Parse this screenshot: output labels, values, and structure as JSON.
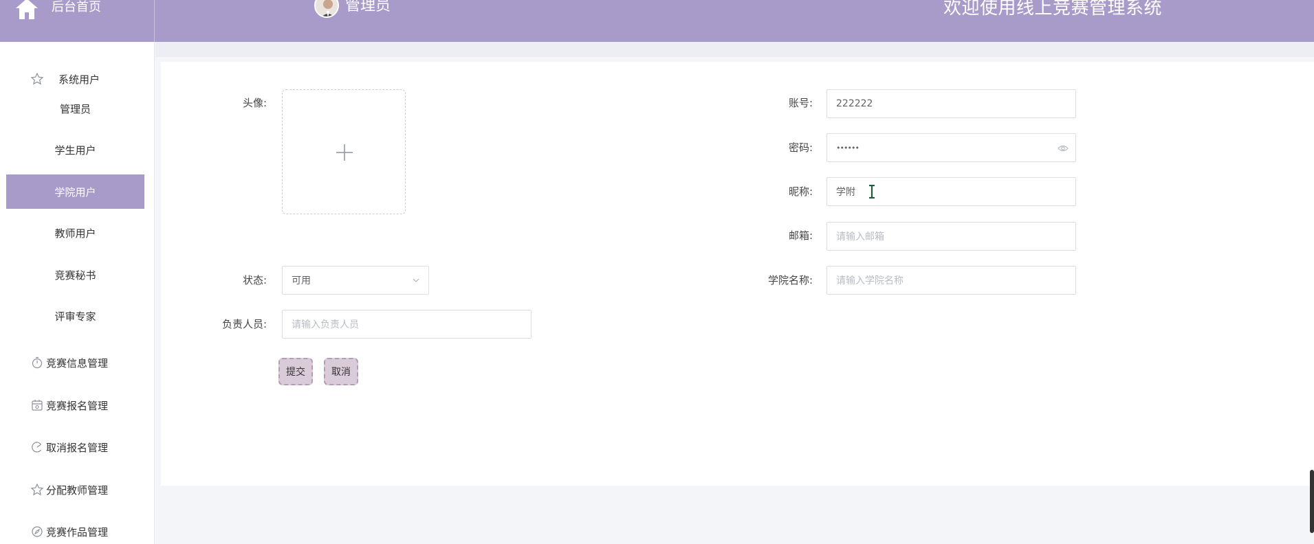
{
  "header": {
    "home_label": "后台首页",
    "admin_name": "管理员",
    "welcome": "欢迎使用线上竞赛管理系统",
    "color": "#a99bc9"
  },
  "sidebar": {
    "system_users": "系统用户",
    "sub_items": [
      "管理员",
      "学生用户",
      "学院用户",
      "教师用户",
      "竞赛秘书",
      "评审专家"
    ],
    "active_item": "学院用户",
    "groups": [
      "竞赛信息管理",
      "竞赛报名管理",
      "取消报名管理",
      "分配教师管理",
      "竞赛作品管理"
    ]
  },
  "form": {
    "avatar_label": "头像:",
    "account_label": "账号:",
    "account_value": "222222",
    "password_label": "密码:",
    "password_value": "••••••",
    "nickname_label": "昵称:",
    "nickname_value": "学附",
    "email_label": "邮箱:",
    "email_placeholder": "请输入邮箱",
    "status_label": "状态:",
    "status_value": "可用",
    "college_label": "学院名称:",
    "college_placeholder": "请输入学院名称",
    "manager_label": "负责人员:",
    "manager_placeholder": "请输入负责人员",
    "submit": "提交",
    "cancel": "取消"
  }
}
